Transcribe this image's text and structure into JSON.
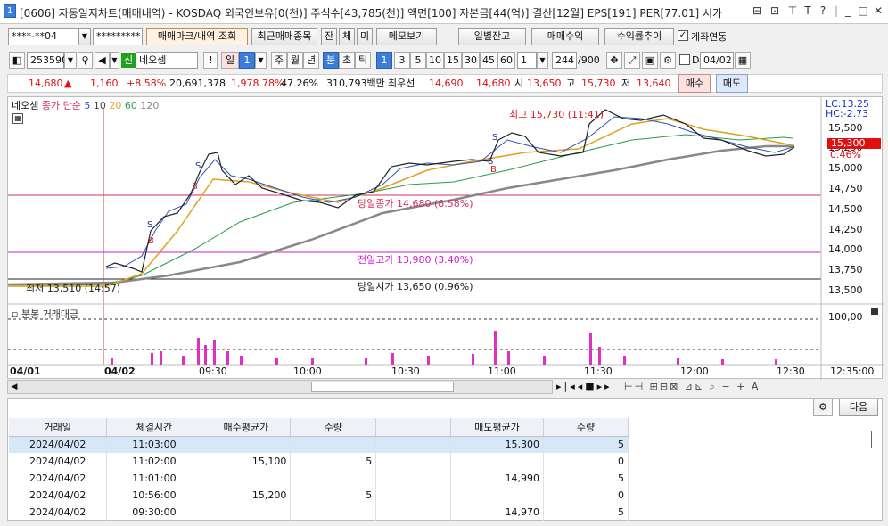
{
  "title": "[0606] 자동일지차트(매매내역) - KOSDAQ 외국인보유[0(천)] 주식수[43,785(천)] 액면[100] 자본금[44(억)] 결산[12월] EPS[191] PER[77.01] 시가",
  "window_controls": [
    "⊟",
    "⊡",
    "⊤",
    "T",
    "?",
    "|",
    "_",
    "□",
    "✕"
  ],
  "toolbar1": {
    "account": "****-**04",
    "password": "*********",
    "btn_trade": "매매마크/내역 조회",
    "btn_recent": "최근매매종목",
    "btn_jan": "잔",
    "btn_che": "체",
    "btn_mi": "미",
    "btn_memo": "메모보기",
    "btn_daily": "일별잔고",
    "btn_profit": "매매수익",
    "btn_yield": "수익률추이",
    "chk_account": "계좌연동"
  },
  "toolbar2": {
    "code": "253590",
    "badge": "신",
    "name": "네오셈",
    "period_btns": [
      "일",
      "1",
      "주",
      "월",
      "년",
      "분",
      "초",
      "틱"
    ],
    "min_btns": [
      "1",
      "3",
      "5",
      "10",
      "15",
      "30",
      "45",
      "60"
    ],
    "count": "1",
    "bars": "244",
    "total": "/900",
    "date": "04/02",
    "chk_d": "D"
  },
  "quote": {
    "price": "14,680",
    "arrow": "▲",
    "change": "1,160",
    "pct": "+8.58%",
    "volume": "20,691,378",
    "vol_pct": "1,978.78%",
    "ratio": "47.26%",
    "amount": "310,793백만",
    "best_label": "최우선",
    "best_ask": "14,690",
    "best_bid": "14,680",
    "open_l": "시",
    "open": "13,650",
    "high_l": "고",
    "high": "15,730",
    "low_l": "저",
    "low": "13,640",
    "buy": "매수",
    "sell": "매도"
  },
  "legend": {
    "name": "네오셈",
    "ma": "종가 단순",
    "p5": "5",
    "p10": "10",
    "p20": "20",
    "p60": "60",
    "p120": "120"
  },
  "annotations": {
    "high": "최고 15,730 (11:41)",
    "low": "최저 13,510 (14:57)",
    "close": "당일종가 14,680 (8.58%)",
    "prevhigh": "전일고가 13,980 (3.40%)",
    "open": "당일시가 13,650 (0.96%)"
  },
  "y_labels": [
    "15,500",
    "15,250",
    "15,000",
    "14,750",
    "14,500",
    "14,250",
    "14,000",
    "13,750",
    "13,500"
  ],
  "lc": "LC:13.25",
  "hc": "HC:-2.73",
  "price_tag": "15,300",
  "pct_tag": "0.46%",
  "vol_legend": "분봉 거래대금",
  "vol_label": "100,00",
  "x_labels": [
    "04/01",
    "04/02",
    "09:30",
    "10:00",
    "10:30",
    "11:00",
    "11:30",
    "12:00",
    "12:30",
    "12:35:00"
  ],
  "grid_next": "다음",
  "table": {
    "headers": [
      "거래일",
      "체결시간",
      "매수평균가",
      "수량",
      "",
      "매도평균가",
      "수량"
    ],
    "rows": [
      [
        "2024/04/02",
        "11:03:00",
        "",
        "",
        "",
        "15,300",
        "5"
      ],
      [
        "2024/04/02",
        "11:02:00",
        "15,100",
        "5",
        "",
        "",
        "0"
      ],
      [
        "2024/04/02",
        "11:01:00",
        "",
        "",
        "",
        "14,990",
        "5"
      ],
      [
        "2024/04/02",
        "10:56:00",
        "15,200",
        "5",
        "",
        "",
        "0"
      ],
      [
        "2024/04/02",
        "09:30:00",
        "",
        "",
        "",
        "14,970",
        "5"
      ]
    ]
  },
  "colors": {
    "up": "#e01010",
    "down": "#1030d0",
    "accent": "#3b7dd8"
  }
}
